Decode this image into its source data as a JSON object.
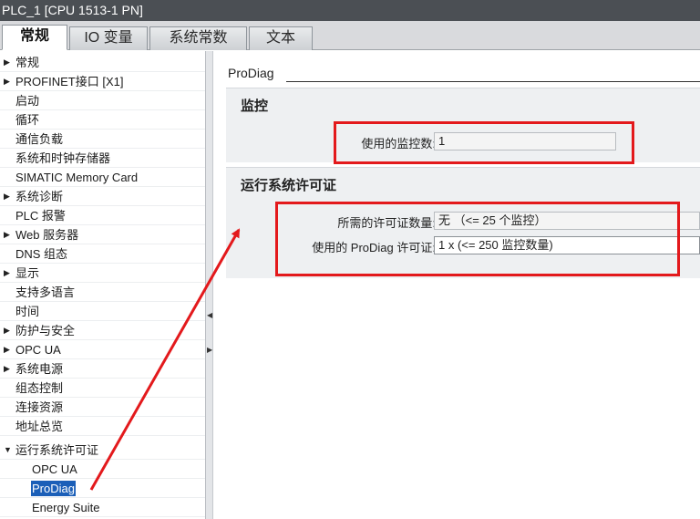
{
  "window": {
    "title": "PLC_1 [CPU 1513-1 PN]"
  },
  "tabs": [
    {
      "label": "常规",
      "active": true
    },
    {
      "label": "IO 变量",
      "active": false
    },
    {
      "label": "系统常数",
      "active": false
    },
    {
      "label": "文本",
      "active": false
    }
  ],
  "sidebar": {
    "items": [
      {
        "label": "常规",
        "arrow": "▶",
        "selected": false
      },
      {
        "label": "PROFINET接口 [X1]",
        "arrow": "▶",
        "selected": false
      },
      {
        "label": "启动",
        "arrow": "",
        "selected": false
      },
      {
        "label": "循环",
        "arrow": "",
        "selected": false
      },
      {
        "label": "通信负载",
        "arrow": "",
        "selected": false
      },
      {
        "label": "系统和时钟存储器",
        "arrow": "",
        "selected": false
      },
      {
        "label": "SIMATIC Memory Card",
        "arrow": "",
        "selected": false
      },
      {
        "label": "系统诊断",
        "arrow": "▶",
        "selected": false
      },
      {
        "label": "PLC 报警",
        "arrow": "",
        "selected": false
      },
      {
        "label": "Web 服务器",
        "arrow": "▶",
        "selected": false
      },
      {
        "label": "DNS 组态",
        "arrow": "",
        "selected": false
      },
      {
        "label": "显示",
        "arrow": "▶",
        "selected": false
      },
      {
        "label": "支持多语言",
        "arrow": "",
        "selected": false
      },
      {
        "label": "时间",
        "arrow": "",
        "selected": false
      },
      {
        "label": "防护与安全",
        "arrow": "▶",
        "selected": false
      },
      {
        "label": "OPC UA",
        "arrow": "▶",
        "selected": false
      },
      {
        "label": "系统电源",
        "arrow": "▶",
        "selected": false
      },
      {
        "label": "组态控制",
        "arrow": "",
        "selected": false
      },
      {
        "label": "连接资源",
        "arrow": "",
        "selected": false
      },
      {
        "label": "地址总览",
        "arrow": "",
        "selected": false
      },
      {
        "label": "运行系统许可证",
        "arrow": "▼",
        "selected": false
      },
      {
        "label": "OPC UA",
        "arrow": "",
        "selected": false
      },
      {
        "label": "ProDiag",
        "arrow": "",
        "selected": true
      },
      {
        "label": "Energy Suite",
        "arrow": "",
        "selected": false
      }
    ]
  },
  "content": {
    "section_title": "ProDiag",
    "monitoring": {
      "title": "监控",
      "label": "使用的监控数:",
      "value": "1"
    },
    "license": {
      "title": "运行系统许可证",
      "required_label": "所需的许可证数量:",
      "required_value": "无 （<= 25 个监控）",
      "used_label": "使用的 ProDiag 许可证:",
      "used_value": "1 x (<= 250 监控数量)"
    }
  },
  "colors": {
    "titlebar": "#4b4f54",
    "selection": "#1b5fb8",
    "highlight": "#e3191c",
    "group_bg": "#eef0f2"
  },
  "icons": {
    "collapsed": "triangle-right-icon",
    "expanded": "triangle-down-icon",
    "splitter": "splitter-arrow-icon"
  }
}
